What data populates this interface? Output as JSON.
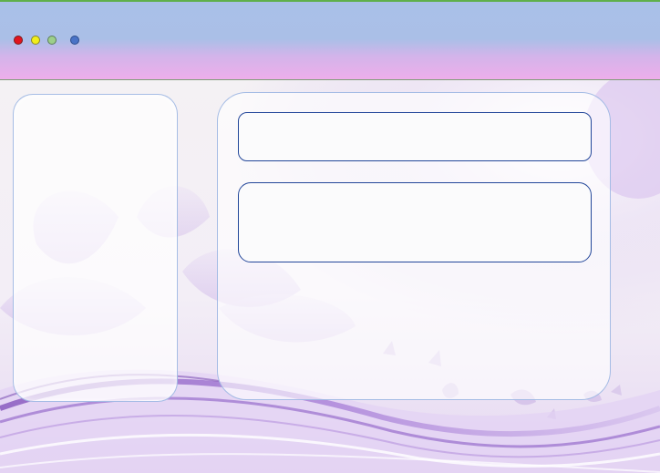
{
  "window": {
    "controls": [
      {
        "name": "close",
        "color": "#e2141f"
      },
      {
        "name": "minimize",
        "color": "#f1ee1b"
      },
      {
        "name": "maximize",
        "color": "#9ccf8a"
      },
      {
        "name": "extra",
        "color": "#4a73c6"
      }
    ],
    "titlebar_gradient": [
      "#a9c0e8",
      "#eeaeeb"
    ],
    "accent": "#23479a"
  },
  "main": {
    "top_field": {
      "value": "",
      "placeholder": ""
    },
    "bottom_field": {
      "value": "",
      "placeholder": ""
    }
  }
}
